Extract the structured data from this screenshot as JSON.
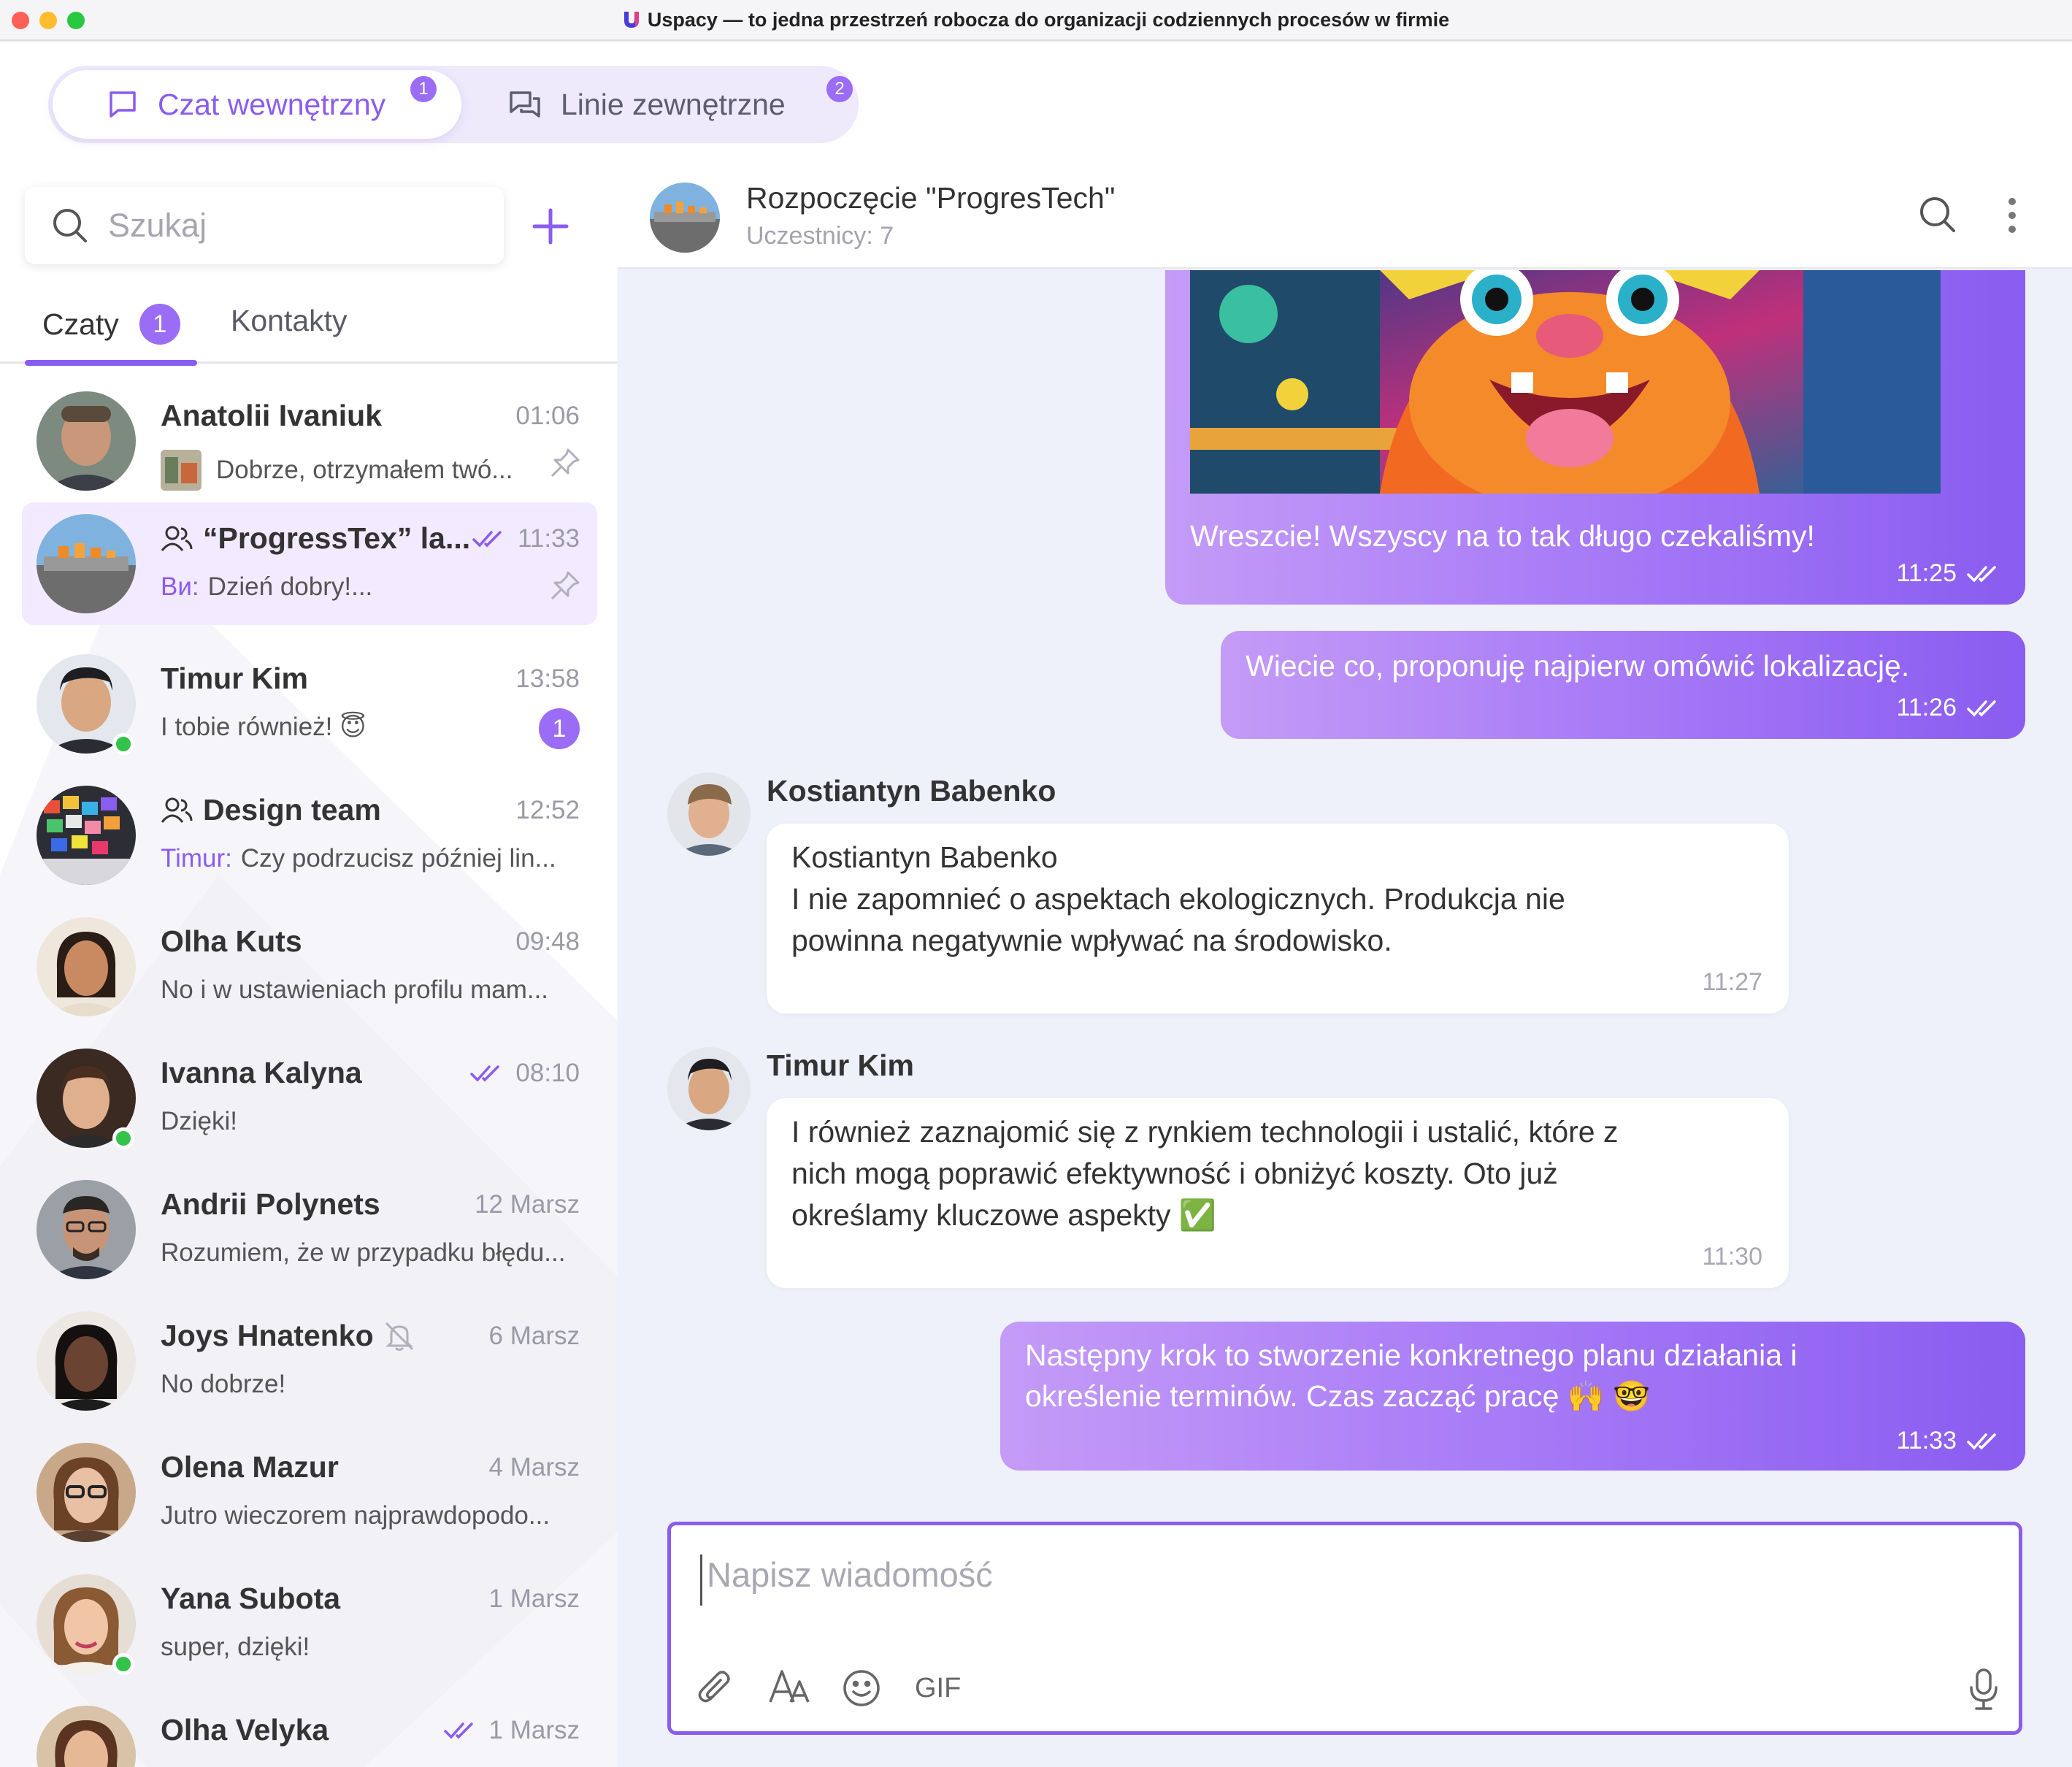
{
  "window": {
    "title": "Uspacy — to jedna przestrzeń robocza do organizacji codziennych procesów w firmie"
  },
  "top_tabs": [
    {
      "label": "Czat wewnętrzny",
      "badge": "1",
      "active": true
    },
    {
      "label": "Linie zewnętrzne",
      "badge": "2",
      "active": false
    }
  ],
  "sidebar": {
    "search_placeholder": "Szukaj",
    "tabs": [
      {
        "label": "Czaty",
        "badge": "1"
      },
      {
        "label": "Kontakty"
      }
    ],
    "chats": [
      {
        "name": "Anatolii Ivaniuk",
        "time": "01:06",
        "preview": "Dobrze, otrzymałem twó...",
        "pinned": true,
        "online": false
      },
      {
        "name": "“ProgressTex” la...",
        "time": "11:33",
        "sender": "Ви:",
        "preview": "Dzień dobry!...",
        "pinned": true,
        "group": true,
        "read": true
      },
      {
        "name": "Timur Kim",
        "time": "13:58",
        "preview": "I tobie również! 😇",
        "unread": "1",
        "online": true
      },
      {
        "name": "Design team",
        "time": "12:52",
        "sender": "Timur:",
        "preview": "Czy podrzucisz później lin...",
        "group": true
      },
      {
        "name": "Olha Kuts",
        "time": "09:48",
        "preview": "No i w ustawieniach profilu mam..."
      },
      {
        "name": "Ivanna Kalyna",
        "time": "08:10",
        "preview": "Dzięki!",
        "read": true,
        "online": true
      },
      {
        "name": "Andrii Polynets",
        "time": "12 Marsz",
        "preview": "Rozumiem, że w przypadku błędu..."
      },
      {
        "name": "Joys Hnatenko",
        "time": "6 Marsz",
        "preview": "No dobrze!",
        "muted": true
      },
      {
        "name": "Olena Mazur",
        "time": "4 Marsz",
        "preview": "Jutro wieczorem najprawdopodo..."
      },
      {
        "name": "Yana Subota",
        "time": "1 Marsz",
        "preview": "super, dzięki!",
        "online": true
      },
      {
        "name": "Olha Velyka",
        "time": "1 Marsz",
        "preview": "",
        "read": true
      }
    ]
  },
  "chat": {
    "title": "Rozpoczęcie \"ProgresTech\"",
    "subtitle": "Uczestnicy: 7",
    "messages": [
      {
        "dir": "out",
        "text": "Wreszcie! Wszyscy na to tak długo czekaliśmy!",
        "time": "11:25"
      },
      {
        "dir": "out",
        "text": "Wiecie co, proponuję najpierw omówić lokalizację.",
        "time": "11:26"
      },
      {
        "dir": "in",
        "sender": "Kostiantyn Babenko",
        "lines": [
          "Kostiantyn Babenko",
          "I nie zapomnieć o aspektach ekologicznych. Produkcja nie",
          "powinna negatywnie wpływać na środowisko."
        ],
        "time": "11:27"
      },
      {
        "dir": "in",
        "sender": "Timur Kim",
        "lines": [
          "I również zaznajomić się z rynkiem technologii i ustalić, które z",
          "nich mogą poprawić efektywność i obniżyć koszty. Oto już",
          "określamy kluczowe aspekty ✅"
        ],
        "time": "11:30"
      },
      {
        "dir": "out",
        "lines": [
          "Następny krok to stworzenie konkretnego planu działania i",
          "określenie terminów. Czas zacząć pracę 🙌 🤓"
        ],
        "time": "11:33"
      }
    ]
  },
  "composer": {
    "placeholder": "Napisz wiadomość",
    "gif_label": "GIF"
  },
  "colors": {
    "accent": "#8a5cf0",
    "badge": "#9b6cf5",
    "online": "#33c24a"
  }
}
